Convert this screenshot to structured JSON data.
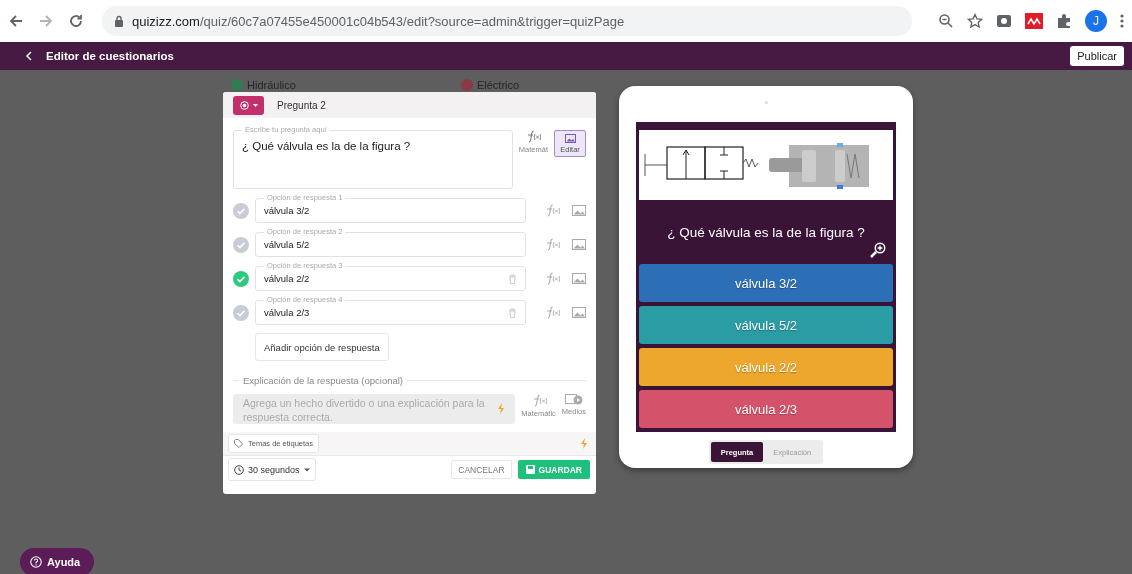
{
  "browser": {
    "url_host": "quizizz.com",
    "url_path": "/quiz/60c7a07455e450001c04b543/edit?source=admin&trigger=quizPage",
    "profile_initial": "J"
  },
  "app_bar": {
    "title": "Editor de cuestionarios",
    "publish_button": "Publicar"
  },
  "background_labels": [
    {
      "label": "Hidráulico",
      "color": "#2e7d4f"
    },
    {
      "label": "Eléctrico",
      "color": "#8b3a45"
    }
  ],
  "editor": {
    "question_number": "Pregunta 2",
    "question_label": "Escribe tu pregunta aquí",
    "question_text": "¿ Qué válvula es la de la figura ?",
    "math_caption": "Matemát",
    "image_caption": "Editar",
    "options": [
      {
        "label": "Opción de respuesta 1",
        "value": "válvula 3/2",
        "correct": false,
        "deletable": false
      },
      {
        "label": "Opción de respuesta 2",
        "value": "válvula 5/2",
        "correct": false,
        "deletable": false
      },
      {
        "label": "Opción de respuesta 3",
        "value": "válvula 2/2",
        "correct": true,
        "deletable": true
      },
      {
        "label": "Opción de respuesta 4",
        "value": "válvula 2/3",
        "correct": false,
        "deletable": true
      }
    ],
    "add_option_button": "Añadir opción de respuesta",
    "explanation": {
      "heading": "Explicación de la respuesta (opcional)",
      "placeholder": "Agrega un hecho divertido o una explicación para la respuesta correcta.",
      "math_caption": "Matemátic",
      "media_caption": "Medios"
    },
    "tags_button": "Temas de etiquetas",
    "time_select": "30 segundos",
    "cancel_button": "CANCELAR",
    "save_button": "GUARDAR"
  },
  "preview": {
    "question": "¿ Qué válvula es la de la figura ?",
    "answers": [
      {
        "text": "válvula 3/2",
        "color": "#2d6fb6"
      },
      {
        "text": "válvula 5/2",
        "color": "#2a9ca3"
      },
      {
        "text": "válvula 2/2",
        "color": "#eca72c"
      },
      {
        "text": "válvula 2/3",
        "color": "#d4536b"
      }
    ],
    "tabs": [
      {
        "label": "Pregunta",
        "selected": true
      },
      {
        "label": "Explicación",
        "selected": false
      }
    ]
  },
  "help_button": "Ayuda"
}
